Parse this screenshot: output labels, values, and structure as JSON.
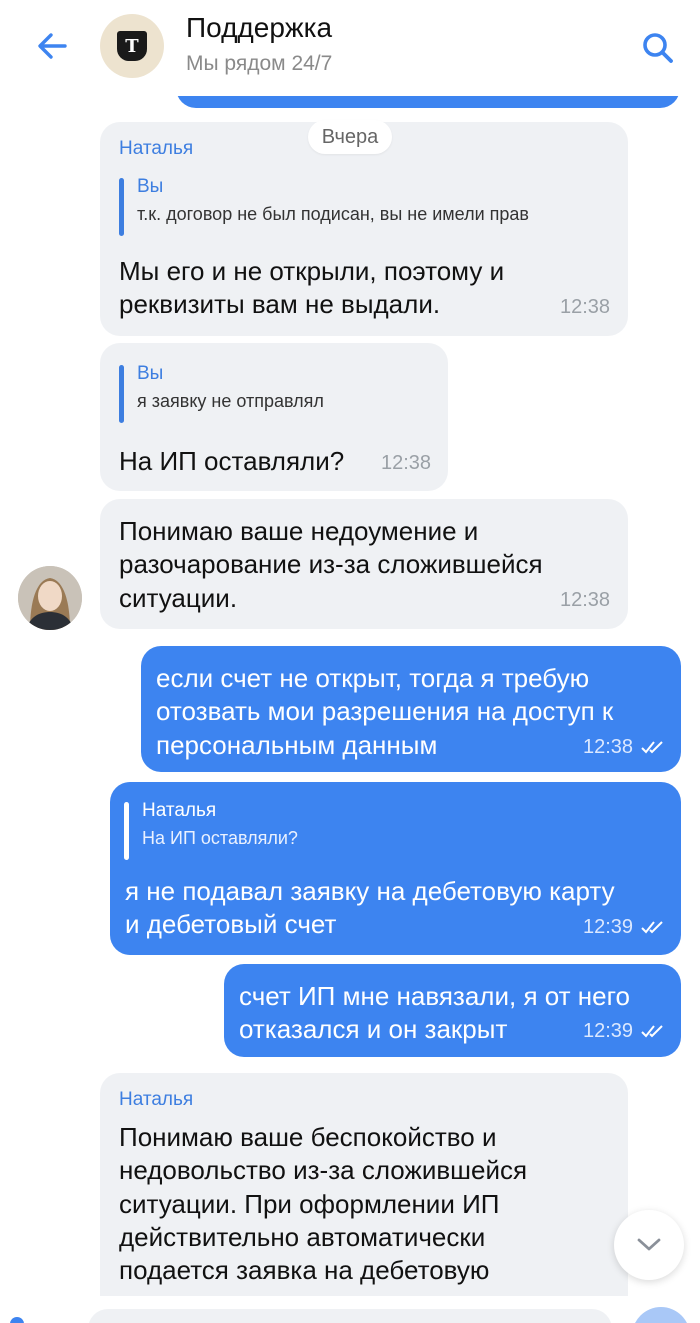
{
  "header": {
    "title": "Поддержка",
    "subtitle": "Мы рядом 24/7",
    "logo_letter": "Т"
  },
  "date_separator": "Вчера",
  "messages": [
    {
      "sender": "Наталья",
      "quote": {
        "name": "Вы",
        "text": "т.к. договор не был подисан, вы не имели прав"
      },
      "text_lines": [
        "Мы его и не открыли, поэтому и",
        "реквизиты вам не выдали."
      ],
      "time": "12:38"
    },
    {
      "quote": {
        "name": "Вы",
        "text": "я заявку не отправлял"
      },
      "text_lines": [
        "На ИП оставляли?"
      ],
      "time": "12:38"
    },
    {
      "text_lines": [
        "Понимаю ваше недоумение и",
        "разочарование из-за сложившейся",
        "ситуации."
      ],
      "time": "12:38"
    },
    {
      "text_lines": [
        "если счет не открыт, тогда я требую",
        "отозвать мои разрешения на доступ к",
        "персональным данным"
      ],
      "time": "12:38"
    },
    {
      "quote": {
        "name": "Наталья",
        "text": "На ИП оставляли?"
      },
      "text_lines": [
        "я не подавал заявку на дебетовую карту",
        "и дебетовый счет"
      ],
      "time": "12:39"
    },
    {
      "text_lines": [
        "счет ИП мне навязали, я от него",
        "отказался и он закрыт"
      ],
      "time": "12:39"
    },
    {
      "sender": "Наталья",
      "text_lines": [
        "Понимаю ваше беспокойство и",
        "недовольство из-за сложившейся",
        "ситуации. При оформлении ИП",
        "действительно автоматически",
        "подается заявка на дебетовую"
      ]
    }
  ],
  "colors": {
    "accent": "#3d84f0",
    "incoming_bubble": "#eff1f4",
    "sender_name": "#3d7ee0"
  },
  "icons": {
    "back": "arrow-left-icon",
    "search": "search-icon",
    "scroll_down": "chevron-down-icon",
    "read_status": "double-check-icon"
  }
}
